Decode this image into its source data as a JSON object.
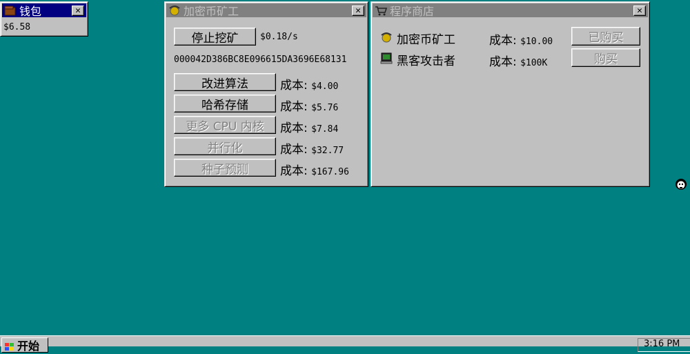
{
  "wallet": {
    "title": "钱包",
    "balance": "$6.58"
  },
  "miner": {
    "title": "加密币矿工",
    "toggle_label": "停止挖矿",
    "rate": "$0.18/s",
    "hash": "000042D386BC8E096615DA3696E68131",
    "upgrades": [
      {
        "label": "改进算法",
        "cost_prefix": "成本:",
        "cost": "$4.00",
        "enabled": true
      },
      {
        "label": "哈希存储",
        "cost_prefix": "成本:",
        "cost": "$5.76",
        "enabled": true
      },
      {
        "label": "更多 CPU 内核",
        "cost_prefix": "成本:",
        "cost": "$7.84",
        "enabled": false
      },
      {
        "label": "并行化",
        "cost_prefix": "成本:",
        "cost": "$32.77",
        "enabled": false
      },
      {
        "label": "种子预测",
        "cost_prefix": "成本:",
        "cost": "$167.96",
        "enabled": false
      }
    ]
  },
  "store": {
    "title": "程序商店",
    "items": [
      {
        "name": "加密币矿工",
        "cost_prefix": "成本:",
        "cost": "$10.00",
        "button": "已购买",
        "icon": "miner-icon"
      },
      {
        "name": "黑客攻击者",
        "cost_prefix": "成本:",
        "cost": "$100K",
        "button": "购买",
        "icon": "hacker-icon"
      }
    ]
  },
  "taskbar": {
    "start_label": "开始",
    "clock": "3:16 PM"
  },
  "close_glyph": "✕",
  "colors": {
    "desktop": "#008080",
    "active_title": "#000080",
    "inactive_title": "#808080",
    "face": "#c0c0c0"
  }
}
